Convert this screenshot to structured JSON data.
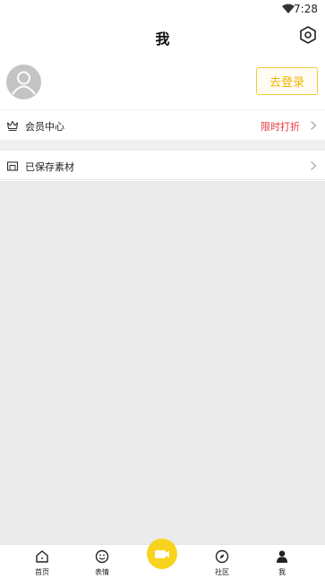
{
  "status_bar": {
    "time": "7:28",
    "wifi_icon": "wifi-icon"
  },
  "header": {
    "title": "我",
    "settings_icon": "settings-icon"
  },
  "profile": {
    "avatar_icon": "avatar-placeholder-icon",
    "login_label": "去登录"
  },
  "menu": {
    "vip": {
      "icon": "crown-icon",
      "label": "会员中心",
      "promo": "限时打折"
    },
    "saved": {
      "icon": "folder-icon",
      "label": "已保存素材"
    }
  },
  "tabbar": {
    "items": [
      {
        "icon": "home-icon",
        "label": "首页"
      },
      {
        "icon": "emoji-icon",
        "label": "表情"
      },
      {
        "icon": "video-camera-icon",
        "label": ""
      },
      {
        "icon": "compass-icon",
        "label": "社区"
      },
      {
        "icon": "person-icon",
        "label": "我"
      }
    ],
    "active": "我"
  },
  "colors": {
    "accent_yellow": "#f8d31d",
    "login_text": "#f0b400",
    "promo_red": "#e5383b",
    "content_bg": "#ebebeb"
  }
}
